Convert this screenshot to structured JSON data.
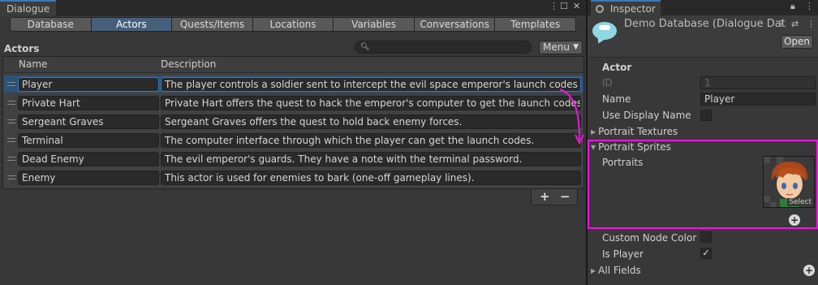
{
  "dialogue": {
    "window_title": "Dialogue",
    "tabs": [
      {
        "label": "Database"
      },
      {
        "label": "Actors"
      },
      {
        "label": "Quests/Items"
      },
      {
        "label": "Locations"
      },
      {
        "label": "Variables"
      },
      {
        "label": "Conversations"
      },
      {
        "label": "Templates"
      }
    ],
    "active_tab": "Actors",
    "section_title": "Actors",
    "search_placeholder": "",
    "menu_label": "Menu",
    "columns": {
      "name": "Name",
      "description": "Description"
    },
    "actors": [
      {
        "name": "Player",
        "description": "The player controls a soldier sent to intercept the evil space emperor's launch codes to"
      },
      {
        "name": "Private Hart",
        "description": "Private Hart offers the quest to hack the emperor's computer to get the launch codes."
      },
      {
        "name": "Sergeant Graves",
        "description": "Sergeant Graves offers the quest to hold back enemy forces."
      },
      {
        "name": "Terminal",
        "description": "The computer interface through which the player can get the launch codes."
      },
      {
        "name": "Dead Enemy",
        "description": "The evil emperor's guards. They have a note with the terminal password."
      },
      {
        "name": "Enemy",
        "description": "This actor is used for enemies to bark (one-off gameplay lines)."
      }
    ],
    "add_label": "+",
    "remove_label": "−"
  },
  "inspector": {
    "window_title": "Inspector",
    "object_name": "Demo Database (Dialogue Dat",
    "open_label": "Open",
    "section_title": "Actor",
    "id_label": "ID",
    "id_value": "1",
    "name_label": "Name",
    "name_value": "Player",
    "use_display_name_label": "Use Display Name",
    "use_display_name": false,
    "portrait_textures_label": "Portrait Textures",
    "portrait_sprites_label": "Portrait Sprites",
    "portraits_label": "Portraits",
    "sprite_select_label": "Select",
    "custom_node_color_label": "Custom Node Color",
    "custom_node_color": false,
    "is_player_label": "Is Player",
    "is_player": true,
    "is_player_mark": "✓",
    "all_fields_label": "All Fields"
  },
  "colors": {
    "selection": "#2d5278",
    "active_tab": "#46607c",
    "highlight": "#ef16e2"
  }
}
